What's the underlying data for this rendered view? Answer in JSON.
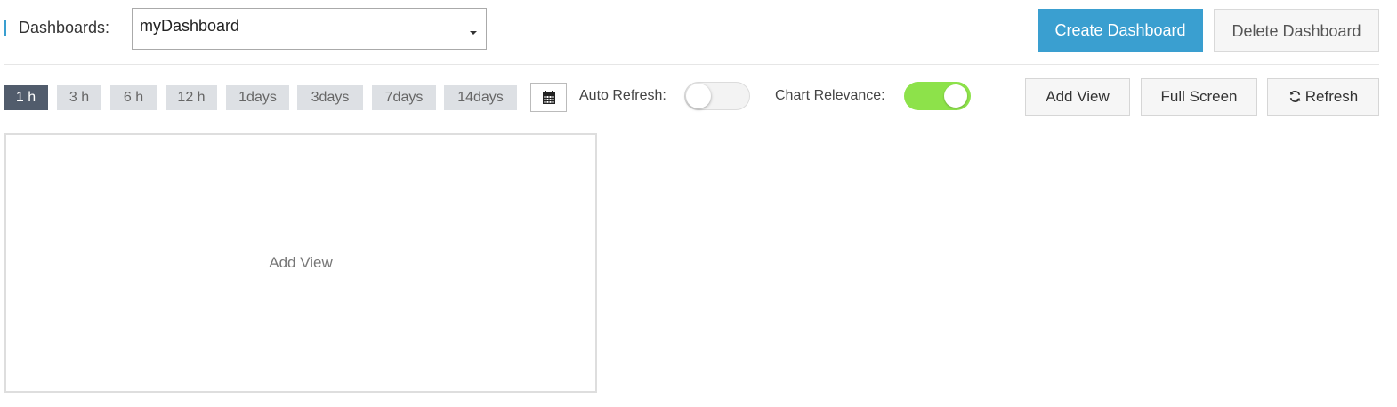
{
  "header": {
    "dashboards_label": "Dashboards:",
    "selected_dashboard": "myDashboard",
    "create_label": "Create Dashboard",
    "delete_label": "Delete Dashboard"
  },
  "time_ranges": [
    "1 h",
    "3 h",
    "6 h",
    "12 h",
    "1days",
    "3days",
    "7days",
    "14days"
  ],
  "active_time_range": "1 h",
  "controls": {
    "calendar_icon": "calendar-icon",
    "auto_refresh_label": "Auto Refresh:",
    "auto_refresh_on": false,
    "chart_relevance_label": "Chart Relevance:",
    "chart_relevance_on": true
  },
  "toolbar": {
    "add_view_label": "Add View",
    "full_screen_label": "Full Screen",
    "refresh_label": "Refresh",
    "refresh_icon": "refresh-icon"
  },
  "panel": {
    "placeholder_label": "Add View"
  },
  "colors": {
    "accent": "#3a9fd0",
    "active_pill": "#515c6c",
    "toggle_on": "#8de24a"
  }
}
